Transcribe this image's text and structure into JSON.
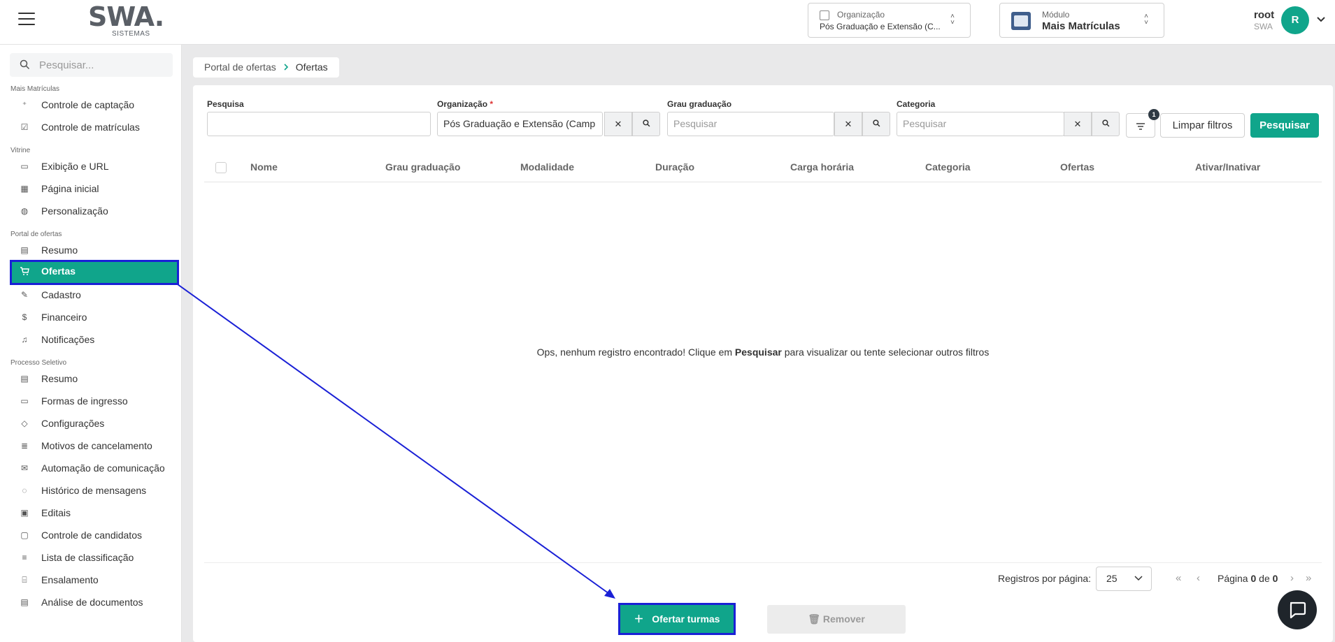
{
  "header": {
    "logo_main": "SWA.",
    "logo_sub": "SISTEMAS",
    "org_selector": {
      "label": "Organização",
      "value": "Pós Graduação e Extensão (C..."
    },
    "module_selector": {
      "label": "Módulo",
      "value": "Mais Matrículas"
    },
    "user": {
      "name": "root",
      "org": "SWA",
      "initial": "R"
    }
  },
  "sidebar": {
    "search_placeholder": "Pesquisar...",
    "sections": [
      {
        "title": "Mais Matrículas",
        "items": [
          {
            "label": "Controle de captação",
            "icon": "user-plus-icon"
          },
          {
            "label": "Controle de matrículas",
            "icon": "checklist-icon"
          }
        ]
      },
      {
        "title": "Vitrine",
        "items": [
          {
            "label": "Exibição e URL",
            "icon": "browser-icon"
          },
          {
            "label": "Página inicial",
            "icon": "grid-icon"
          },
          {
            "label": "Personalização",
            "icon": "palette-icon"
          }
        ]
      },
      {
        "title": "Portal de ofertas",
        "items": [
          {
            "label": "Resumo",
            "icon": "summary-icon"
          },
          {
            "label": "Ofertas",
            "icon": "cart-icon",
            "active": true
          },
          {
            "label": "Cadastro",
            "icon": "user-edit-icon"
          },
          {
            "label": "Financeiro",
            "icon": "dollar-icon"
          },
          {
            "label": "Notificações",
            "icon": "bell-icon"
          }
        ]
      },
      {
        "title": "Processo Seletivo",
        "items": [
          {
            "label": "Resumo",
            "icon": "summary-icon"
          },
          {
            "label": "Formas de ingresso",
            "icon": "id-card-icon"
          },
          {
            "label": "Configurações",
            "icon": "mortarboard-icon"
          },
          {
            "label": "Motivos de cancelamento",
            "icon": "cancel-doc-icon"
          },
          {
            "label": "Automação de comunicação",
            "icon": "mail-icon"
          },
          {
            "label": "Histórico de mensagens",
            "icon": "chat-history-icon"
          },
          {
            "label": "Editais",
            "icon": "calendar-icon"
          },
          {
            "label": "Controle de candidatos",
            "icon": "window-icon"
          },
          {
            "label": "Lista de classificação",
            "icon": "ordered-list-icon"
          },
          {
            "label": "Ensalamento",
            "icon": "seat-icon"
          },
          {
            "label": "Análise de documentos",
            "icon": "document-icon"
          }
        ]
      }
    ]
  },
  "breadcrumb": {
    "parent": "Portal de ofertas",
    "current": "Ofertas"
  },
  "filters": {
    "search": {
      "label": "Pesquisa",
      "value": ""
    },
    "organization": {
      "label": "Organização",
      "required": "*",
      "value": "Pós Graduação e Extensão (Camp"
    },
    "grade": {
      "label": "Grau graduação",
      "placeholder": "Pesquisar"
    },
    "category": {
      "label": "Categoria",
      "placeholder": "Pesquisar"
    },
    "filter_count": "1",
    "clear_label": "Limpar filtros",
    "search_label": "Pesquisar"
  },
  "table": {
    "columns": [
      "Nome",
      "Grau graduação",
      "Modalidade",
      "Duração",
      "Carga horária",
      "Categoria",
      "Ofertas",
      "Ativar/Inativar"
    ],
    "empty_prefix": "Ops, nenhum registro encontrado! Clique em ",
    "empty_bold": "Pesquisar",
    "empty_suffix": " para visualizar ou tente selecionar outros filtros"
  },
  "pagination": {
    "rows_label": "Registros por página:",
    "rows_value": "25",
    "page_label": "Página",
    "page_current": "0",
    "page_of": "de",
    "page_total": "0"
  },
  "actions": {
    "offer_label": "Ofertar turmas",
    "remove_label": "Remover"
  },
  "colors": {
    "accent": "#10a58b",
    "annotation": "#1a20d6"
  }
}
